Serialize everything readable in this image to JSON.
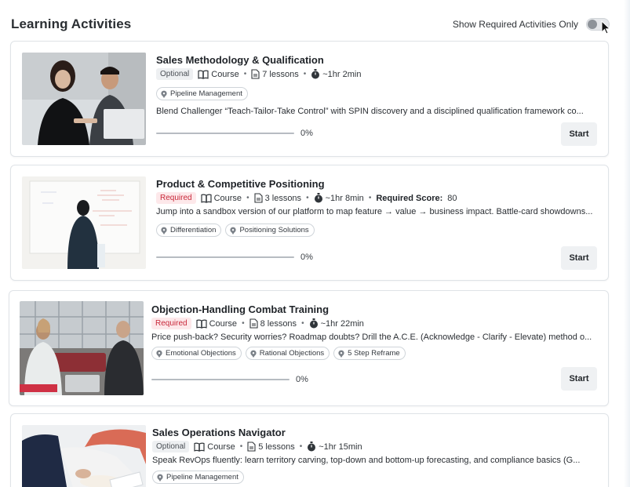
{
  "header": {
    "title": "Learning Activities",
    "toggle_label": "Show Required Activities Only",
    "toggle_on": false
  },
  "activities": [
    {
      "title": "Sales Methodology & Qualification",
      "badge": "Optional",
      "type": "Course",
      "lessons": "7 lessons",
      "duration": "~1hr 2min",
      "tags": [
        "Pipeline Management"
      ],
      "description": "Blend Challenger “Teach-Tailor-Take Control” with SPIN discovery and a disciplined qualification framework co...",
      "progress": "0%",
      "button": "Start"
    },
    {
      "title": "Product & Competitive Positioning",
      "badge": "Required",
      "type": "Course",
      "lessons": "3 lessons",
      "duration": "~1hr 8min",
      "required_score_label": "Required Score:",
      "required_score": "80",
      "tags": [
        "Differentiation",
        "Positioning Solutions"
      ],
      "description": "Jump into a sandbox version of our platform to map feature → value → business impact. Battle-card showdowns...",
      "progress": "0%",
      "button": "Start"
    },
    {
      "title": "Objection-Handling Combat Training",
      "badge": "Required",
      "type": "Course",
      "lessons": "8 lessons",
      "duration": "~1hr 22min",
      "tags": [
        "Emotional Objections",
        "Rational Objections",
        "5 Step Reframe"
      ],
      "description": "Price push-back? Security worries? Roadmap doubts? Drill the A.C.E. (Acknowledge - Clarify - Elevate) method o...",
      "progress": "0%",
      "button": "Start"
    },
    {
      "title": "Sales Operations Navigator",
      "badge": "Optional",
      "type": "Course",
      "lessons": "5 lessons",
      "duration": "~1hr 15min",
      "tags": [
        "Pipeline Management"
      ],
      "description": "Speak RevOps fluently: learn territory carving, top-down and bottom-up forecasting, and compliance basics (G...",
      "progress": "",
      "button": ""
    }
  ],
  "colors": {
    "required_text": "#c8283a",
    "required_bg": "#fde8ea",
    "optional_bg": "#eef0f2"
  },
  "icons": [
    "book-icon",
    "document-icon",
    "stopwatch-icon",
    "tag-icon",
    "cursor-icon"
  ]
}
